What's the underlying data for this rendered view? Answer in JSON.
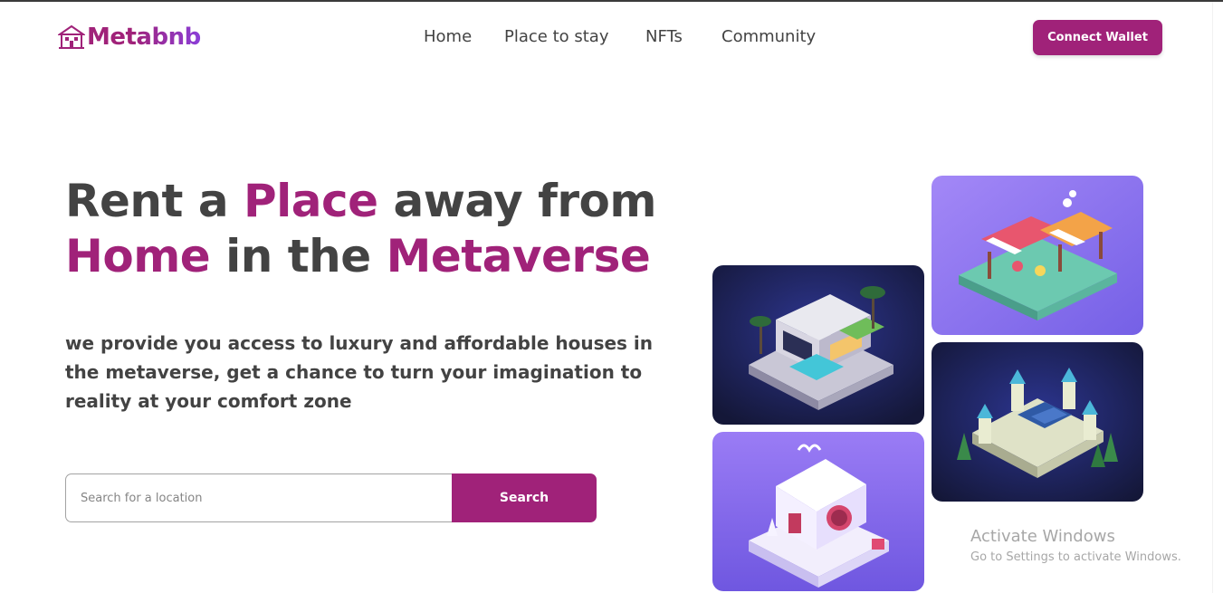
{
  "header": {
    "brand": "Metabnb",
    "nav": [
      "Home",
      "Place to stay",
      "NFTs",
      "Community"
    ],
    "connect_label": "Connect Wallet"
  },
  "hero": {
    "headline": {
      "w1": "Rent a ",
      "w2": "Place",
      "w3": " away from",
      "w4": "Home",
      "w5": " in the ",
      "w6": "Metaverse"
    },
    "description": "we provide you access to luxury and affordable houses in the metaverse, get a chance to turn your imagination to reality at your comfort zone",
    "search": {
      "placeholder": "Search for a location",
      "button_label": "Search"
    }
  },
  "gallery": {
    "cards": [
      "modern-villa-nft",
      "market-stall-nft",
      "castle-nft",
      "snow-cottage-nft"
    ]
  },
  "watermark": {
    "title": "Activate Windows",
    "subtitle": "Go to Settings to activate Windows."
  },
  "colors": {
    "accent": "#a02279",
    "text": "#434343",
    "violet": "#8b6cf0",
    "navy": "#1e2260"
  }
}
